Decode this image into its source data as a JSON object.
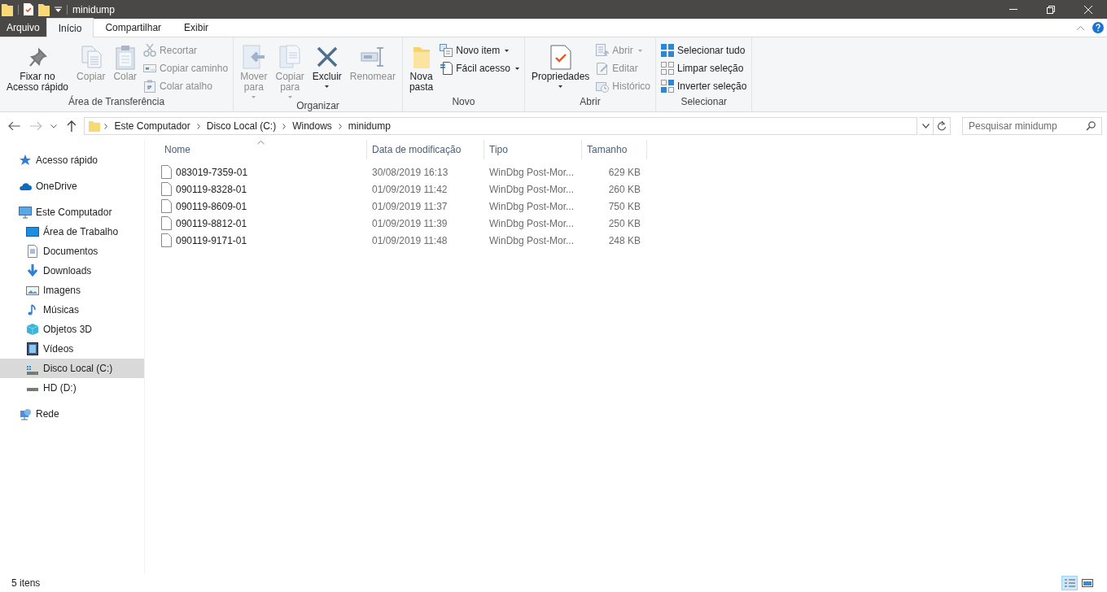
{
  "window": {
    "title": "minidump"
  },
  "tabs": [
    {
      "label": "Arquivo",
      "kind": "file",
      "selected": false
    },
    {
      "label": "Início",
      "kind": "tab",
      "selected": true
    },
    {
      "label": "Compartilhar",
      "kind": "tab",
      "selected": false
    },
    {
      "label": "Exibir",
      "kind": "tab",
      "selected": false
    }
  ],
  "ribbon": {
    "groups": [
      {
        "label": "Área de Transferência",
        "items": [
          {
            "label": "Fixar no\nAcesso rápido",
            "kind": "large",
            "disabled": false,
            "dropdown": false
          },
          {
            "label": "Copiar",
            "kind": "large",
            "disabled": true,
            "dropdown": false
          },
          {
            "label": "Colar",
            "kind": "large",
            "disabled": true,
            "dropdown": false
          },
          {
            "label": "Recortar",
            "kind": "small",
            "disabled": true,
            "dropdown": false
          },
          {
            "label": "Copiar caminho",
            "kind": "small",
            "disabled": true,
            "dropdown": false
          },
          {
            "label": "Colar atalho",
            "kind": "small",
            "disabled": true,
            "dropdown": false
          }
        ]
      },
      {
        "label": "Organizar",
        "items": [
          {
            "label": "Mover\npara",
            "kind": "large",
            "disabled": true,
            "dropdown": true
          },
          {
            "label": "Copiar\npara",
            "kind": "large",
            "disabled": true,
            "dropdown": true
          },
          {
            "label": "Excluir",
            "kind": "large",
            "disabled": false,
            "dropdown": true
          },
          {
            "label": "Renomear",
            "kind": "large",
            "disabled": true,
            "dropdown": false
          }
        ]
      },
      {
        "label": "Novo",
        "items": [
          {
            "label": "Nova\npasta",
            "kind": "large",
            "disabled": false,
            "dropdown": false
          },
          {
            "label": "Novo item",
            "kind": "small",
            "disabled": false,
            "dropdown": true
          },
          {
            "label": "Fácil acesso",
            "kind": "small",
            "disabled": false,
            "dropdown": true
          }
        ]
      },
      {
        "label": "Abrir",
        "items": [
          {
            "label": "Propriedades",
            "kind": "large",
            "disabled": false,
            "dropdown": true
          },
          {
            "label": "Abrir",
            "kind": "small",
            "disabled": true,
            "dropdown": true
          },
          {
            "label": "Editar",
            "kind": "small",
            "disabled": true,
            "dropdown": false
          },
          {
            "label": "Histórico",
            "kind": "small",
            "disabled": true,
            "dropdown": false
          }
        ]
      },
      {
        "label": "Selecionar",
        "items": [
          {
            "label": "Selecionar tudo",
            "kind": "small",
            "disabled": false,
            "dropdown": false
          },
          {
            "label": "Limpar seleção",
            "kind": "small",
            "disabled": false,
            "dropdown": false
          },
          {
            "label": "Inverter seleção",
            "kind": "small",
            "disabled": false,
            "dropdown": false
          }
        ]
      }
    ]
  },
  "address_bar": {
    "path": [
      "Este Computador",
      "Disco Local (C:)",
      "Windows",
      "minidump"
    ]
  },
  "search": {
    "placeholder": "Pesquisar minidump"
  },
  "sidebar": {
    "items": [
      {
        "label": "Acesso rápido",
        "selected": false
      },
      {
        "label": "OneDrive",
        "selected": false
      },
      {
        "label": "Este Computador",
        "selected": false,
        "children": [
          {
            "label": "Área de Trabalho",
            "selected": false
          },
          {
            "label": "Documentos",
            "selected": false
          },
          {
            "label": "Downloads",
            "selected": false
          },
          {
            "label": "Imagens",
            "selected": false
          },
          {
            "label": "Músicas",
            "selected": false
          },
          {
            "label": "Objetos 3D",
            "selected": false
          },
          {
            "label": "Vídeos",
            "selected": false
          },
          {
            "label": "Disco Local (C:)",
            "selected": true
          },
          {
            "label": "HD (D:)",
            "selected": false
          }
        ]
      },
      {
        "label": "Rede",
        "selected": false
      }
    ]
  },
  "table": {
    "columns": [
      {
        "label": "Nome",
        "sorted": true
      },
      {
        "label": "Data de modificação",
        "sorted": false
      },
      {
        "label": "Tipo",
        "sorted": false
      },
      {
        "label": "Tamanho",
        "sorted": false
      }
    ],
    "rows": [
      [
        "083019-7359-01",
        "30/08/2019 16:13",
        "WinDbg Post-Mor...",
        "629 KB"
      ],
      [
        "090119-8328-01",
        "01/09/2019 11:42",
        "WinDbg Post-Mor...",
        "260 KB"
      ],
      [
        "090119-8609-01",
        "01/09/2019 11:37",
        "WinDbg Post-Mor...",
        "750 KB"
      ],
      [
        "090119-8812-01",
        "01/09/2019 11:39",
        "WinDbg Post-Mor...",
        "250 KB"
      ],
      [
        "090119-9171-01",
        "01/09/2019 11:48",
        "WinDbg Post-Mor...",
        "248 KB"
      ]
    ]
  },
  "status_bar": {
    "text": "5 itens",
    "views": [
      {
        "kind": "details",
        "selected": true
      },
      {
        "kind": "tiles",
        "selected": false
      }
    ]
  }
}
